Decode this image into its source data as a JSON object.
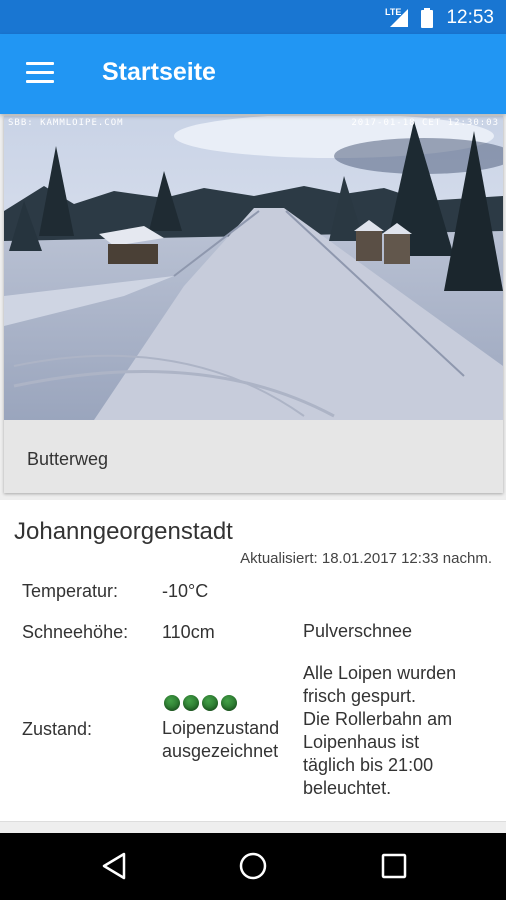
{
  "status_bar": {
    "network": "LTE",
    "time": "12:53"
  },
  "app_bar": {
    "title": "Startseite",
    "menu_icon": "hamburger-menu-icon"
  },
  "webcam": {
    "overlay_left": "SBB: KAMMLOIPE.COM",
    "overlay_right": "2017-01-18 CET 12:30:03",
    "caption": "Butterweg"
  },
  "location": {
    "name": "Johanngeorgenstadt",
    "updated": "Aktualisiert: 18.01.2017 12:33 nachm."
  },
  "conditions": {
    "temperature_label": "Temperatur:",
    "temperature_value": "-10°C",
    "snow_label": "Schneehöhe:",
    "snow_value": "110cm",
    "snow_type": "Pulverschnee",
    "state_label": "Zustand:",
    "state_rating": 4,
    "state_color": "#2e7d32",
    "state_text_line1": "Loipenzustand",
    "state_text_line2": "ausgezeichnet",
    "notes_lines": [
      "Alle Loipen wurden",
      "frisch gespurt.",
      "Die Rollerbahn am",
      "Loipenhaus ist",
      "täglich bis 21:00",
      "beleuchtet."
    ]
  },
  "nav_bar": {
    "back_icon": "back-triangle-icon",
    "home_icon": "home-circle-icon",
    "recents_icon": "recents-square-icon"
  },
  "colors": {
    "status_bar": "#1976d2",
    "app_bar": "#2196f3"
  }
}
